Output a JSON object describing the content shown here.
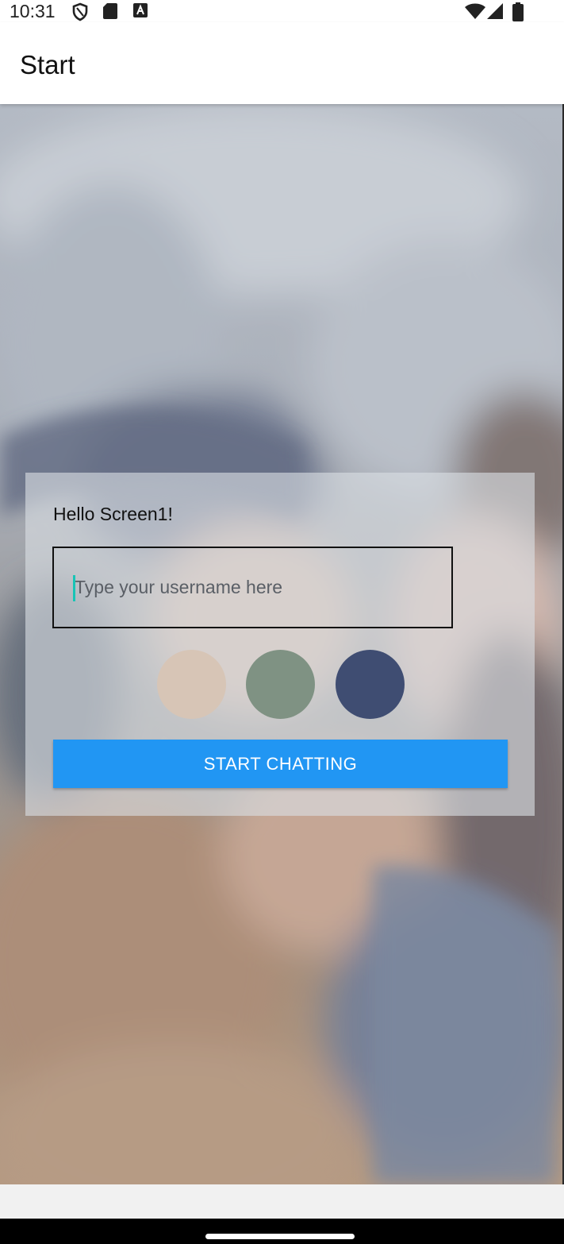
{
  "status_bar": {
    "time": "10:31",
    "left_icons": [
      "shield-icon",
      "sd-card-icon",
      "keyboard-a-icon"
    ],
    "right_icons": [
      "wifi-icon",
      "cell-signal-icon",
      "battery-icon"
    ]
  },
  "app_bar": {
    "title": "Start"
  },
  "start_card": {
    "greeting": "Hello Screen1!",
    "username_input": {
      "value": "",
      "placeholder": "Type your username here"
    },
    "color_options": [
      {
        "name": "beige",
        "color": "#d7c5b6"
      },
      {
        "name": "sage",
        "color": "#7f9283"
      },
      {
        "name": "navy",
        "color": "#3f4d72"
      }
    ],
    "start_button_label": "START CHATTING",
    "button_color": "#2196f3"
  }
}
